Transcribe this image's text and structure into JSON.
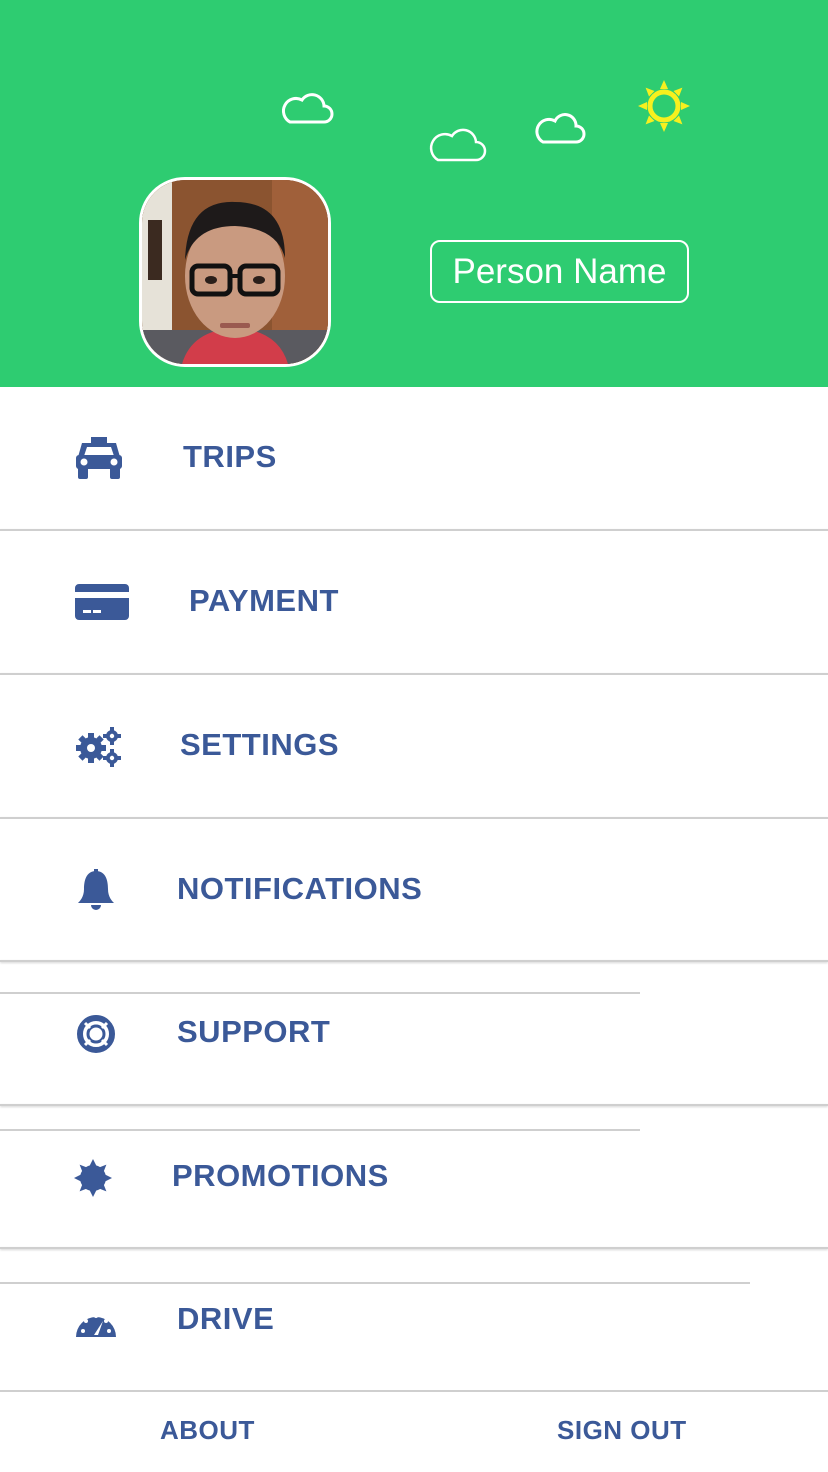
{
  "header": {
    "person_name": "Person Name",
    "background_color": "#2ecc71",
    "sun_color": "#f7f01e"
  },
  "menu": {
    "items": [
      {
        "label": "TRIPS",
        "icon": "taxi-icon"
      },
      {
        "label": "PAYMENT",
        "icon": "credit-card-icon"
      },
      {
        "label": "SETTINGS",
        "icon": "cogs-icon"
      },
      {
        "label": "NOTIFICATIONS",
        "icon": "bell-icon"
      },
      {
        "label": "SUPPORT",
        "icon": "life-ring-icon"
      },
      {
        "label": "PROMOTIONS",
        "icon": "badge-icon"
      },
      {
        "label": "DRIVE",
        "icon": "speedometer-icon"
      }
    ],
    "text_color": "#3b5998"
  },
  "footer": {
    "about_label": "ABOUT",
    "sign_out_label": "SIGN OUT"
  }
}
